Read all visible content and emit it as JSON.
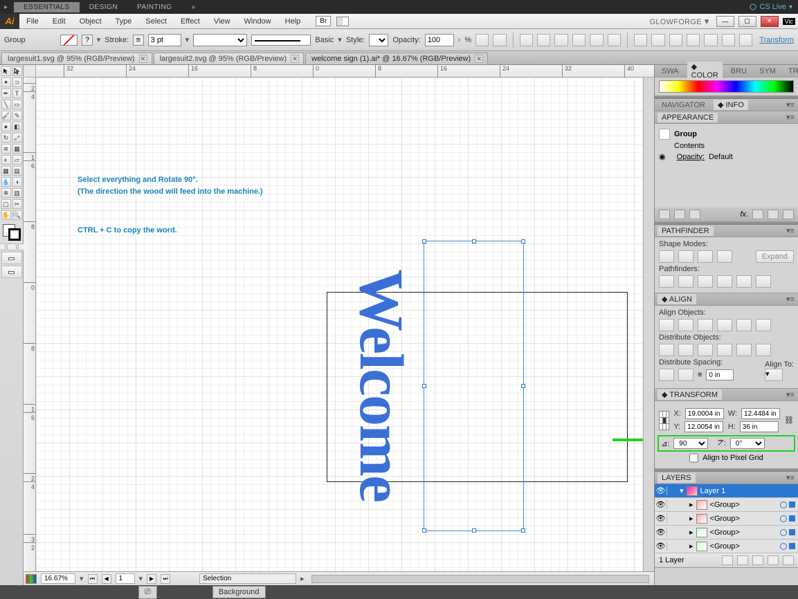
{
  "topbar": {
    "tabs": [
      "ESSENTIALS",
      "DESIGN",
      "PAINTING"
    ],
    "active": 0,
    "cs": "CS Live",
    "chevron": "»"
  },
  "menu": {
    "items": [
      "File",
      "Edit",
      "Object",
      "Type",
      "Select",
      "Effect",
      "View",
      "Window",
      "Help"
    ],
    "br": "Br",
    "workspace": "GLOWFORGE",
    "vic": "Vic"
  },
  "options": {
    "label": "Group",
    "stroke_lbl": "Stroke:",
    "stroke_val": "3 pt",
    "brush_lbl": "Basic",
    "style_lbl": "Style:",
    "opacity_lbl": "Opacity:",
    "opacity_val": "100",
    "pct": "%",
    "transform": "Transform"
  },
  "docs": [
    {
      "name": "largesuit1.svg @ 95% (RGB/Preview)"
    },
    {
      "name": "largesuit2.svg @ 95% (RGB/Preview)"
    },
    {
      "name": "welcome sign (1).ai* @ 16.67% (RGB/Preview)",
      "active": true
    }
  ],
  "rulers": {
    "h": [
      "32",
      "24",
      "16",
      "8",
      "0",
      "8",
      "16",
      "24",
      "32",
      "40"
    ],
    "v": [
      "2",
      "4",
      "1",
      "6",
      "8",
      "0",
      "8",
      "1",
      "6",
      "2",
      "4",
      "3",
      "2"
    ]
  },
  "canvas": {
    "line1": "Select everything and Rotate 90°.",
    "line2": "(The direction the wood will feed into the machine.)",
    "line3": "CTRL + C to copy the word.",
    "script": "Welcome"
  },
  "status": {
    "zoom": "16.67%",
    "page": "1",
    "tool": "Selection",
    "bg": "Background"
  },
  "rightTabs1": {
    "swatches": "SWA",
    "color": "COLOR",
    "brushes": "BRU",
    "symbols": "SYM",
    "trai": "TRAI"
  },
  "navigator": {
    "nav": "NAVIGATOR",
    "info": "INFO"
  },
  "appearance": {
    "title": "APPEARANCE",
    "group": "Group",
    "contents": "Contents",
    "opacity_lbl": "Opacity:",
    "opacity_val": "Default"
  },
  "pathfinder": {
    "title": "PATHFINDER",
    "shape": "Shape Modes:",
    "expand": "Expand",
    "pf": "Pathfinders:"
  },
  "align": {
    "title": "ALIGN",
    "aobj": "Align Objects:",
    "dobj": "Distribute Objects:",
    "dspc": "Distribute Spacing:",
    "ato": "Align To:",
    "spc": "0 in"
  },
  "transform": {
    "title": "TRANSFORM",
    "x_lbl": "X:",
    "x": "19.0004 in",
    "y_lbl": "Y:",
    "y": "12.0054 in",
    "w_lbl": "W:",
    "w": "12.4484 in",
    "h_lbl": "H:",
    "h": "36 in",
    "angle": "90",
    "shear": "0°",
    "pixel": "Align to Pixel Grid"
  },
  "layers": {
    "title": "LAYERS",
    "layer1": "Layer 1",
    "grp": "<Group>",
    "count": "1 Layer"
  }
}
